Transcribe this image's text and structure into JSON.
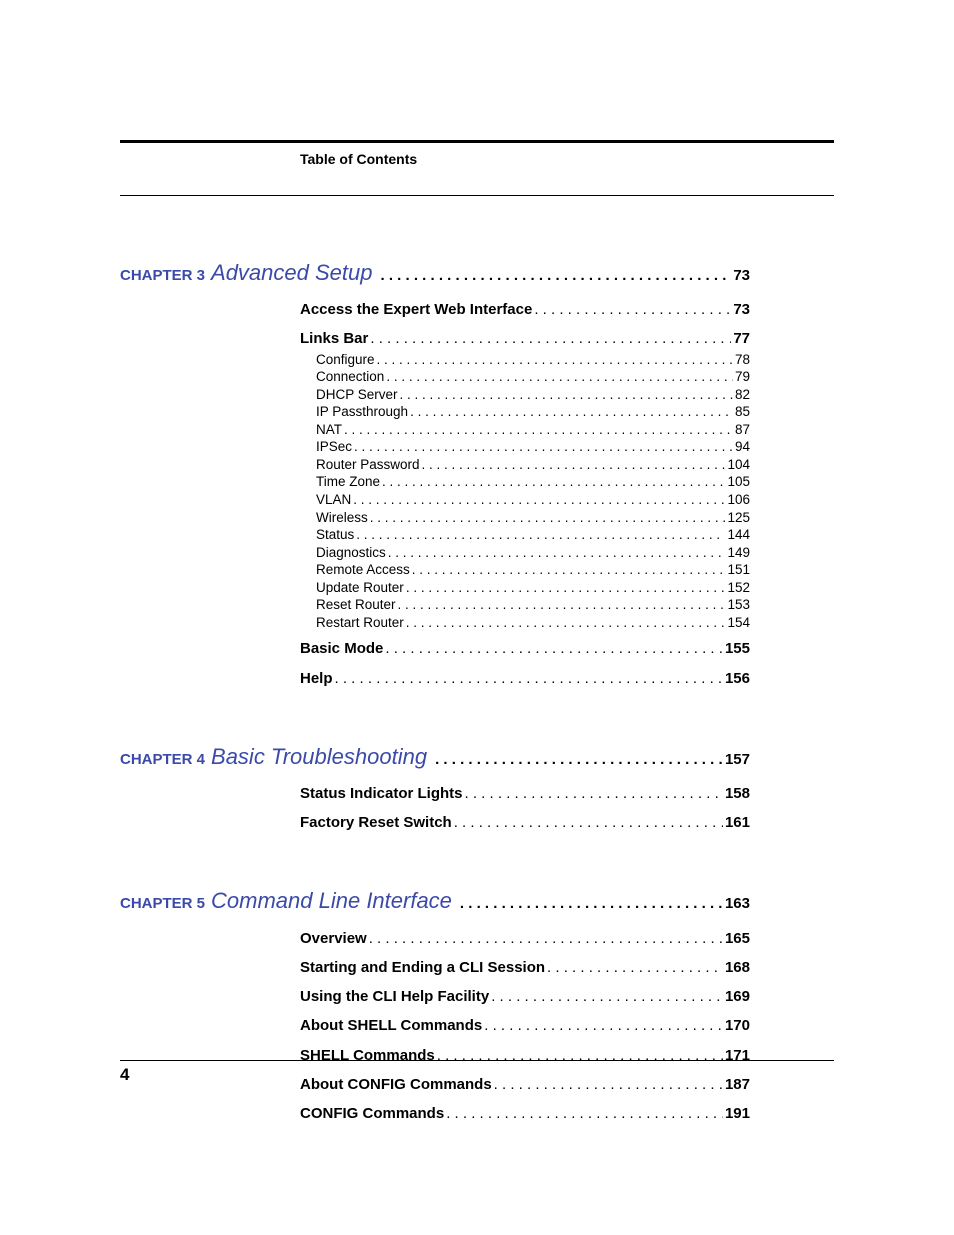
{
  "header": {
    "title": "Table of Contents"
  },
  "footer": {
    "page_number": "4"
  },
  "chapters": [
    {
      "label": "CHAPTER 3",
      "title": "Advanced Setup",
      "page": "73",
      "sections": [
        {
          "label": "Access the Expert Web Interface",
          "page": "73",
          "subs": []
        },
        {
          "label": "Links Bar",
          "page": "77",
          "subs": [
            {
              "label": "Configure",
              "page": "78"
            },
            {
              "label": "Connection",
              "page": "79"
            },
            {
              "label": "DHCP Server",
              "page": "82"
            },
            {
              "label": "IP Passthrough",
              "page": "85"
            },
            {
              "label": "NAT",
              "page": "87"
            },
            {
              "label": "IPSec",
              "page": "94"
            },
            {
              "label": "Router Password",
              "page": "104"
            },
            {
              "label": "Time Zone",
              "page": "105"
            },
            {
              "label": "VLAN",
              "page": "106"
            },
            {
              "label": "Wireless",
              "page": "125"
            },
            {
              "label": "Status",
              "page": "144"
            },
            {
              "label": "Diagnostics",
              "page": "149"
            },
            {
              "label": "Remote Access",
              "page": "151"
            },
            {
              "label": "Update Router",
              "page": "152"
            },
            {
              "label": "Reset Router",
              "page": "153"
            },
            {
              "label": "Restart Router",
              "page": "154"
            }
          ]
        },
        {
          "label": "Basic Mode",
          "page": "155",
          "subs": []
        },
        {
          "label": "Help",
          "page": "156",
          "subs": []
        }
      ]
    },
    {
      "label": "CHAPTER 4",
      "title": "Basic Troubleshooting",
      "page": "157",
      "sections": [
        {
          "label": "Status Indicator Lights",
          "page": "158",
          "subs": []
        },
        {
          "label": "Factory Reset Switch",
          "page": "161",
          "subs": []
        }
      ]
    },
    {
      "label": "CHAPTER 5",
      "title": "Command Line Interface",
      "page": "163",
      "sections": [
        {
          "label": "Overview",
          "page": "165",
          "subs": []
        },
        {
          "label": "Starting and Ending a CLI Session",
          "page": "168",
          "subs": []
        },
        {
          "label": "Using the CLI Help Facility",
          "page": "169",
          "subs": []
        },
        {
          "label": "About SHELL Commands",
          "page": "170",
          "subs": []
        },
        {
          "label": "SHELL Commands",
          "page": "171",
          "subs": []
        },
        {
          "label": "About CONFIG Commands",
          "page": "187",
          "subs": []
        },
        {
          "label": "CONFIG Commands",
          "page": "191",
          "subs": []
        }
      ]
    }
  ]
}
